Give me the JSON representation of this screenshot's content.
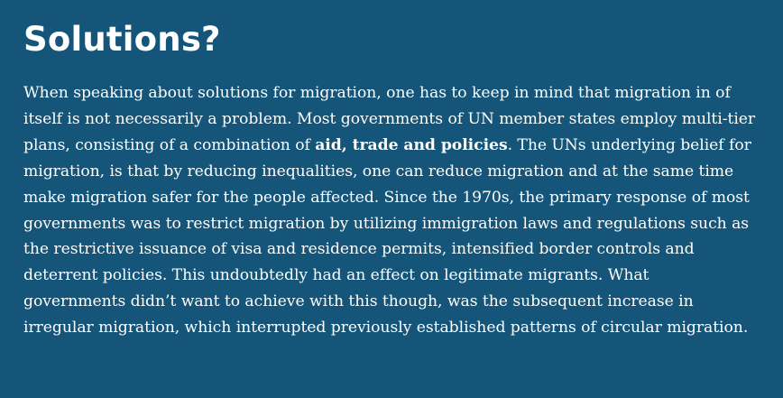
{
  "section": {
    "title": "Solutions?",
    "paragraph": {
      "intro": "When speaking about solutions for migration, one has to keep in mind that migration in of itself is not necessarily a problem. Most governments of UN member states employ multi-tier plans, consisting of a combination of ",
      "emphasis": "aid, trade and policies",
      "rest": ". The UNs underlying belief for migration, is that by reducing inequalities, one can reduce migration and at the same time make migration safer for the people affected. Since the 1970s, the primary response of most governments was to restrict migration by utilizing immigration laws and regulations such as the restrictive issuance of visa and residence permits, intensified border controls and deterrent policies. This undoubtedly had an effect on legitimate migrants. What governments didn’t want to achieve with this though, was the subsequent increase in irregular migration, which interrupted previously established patterns of circular migration."
    }
  },
  "colors": {
    "background": "#145579",
    "text": "#ffffff"
  }
}
